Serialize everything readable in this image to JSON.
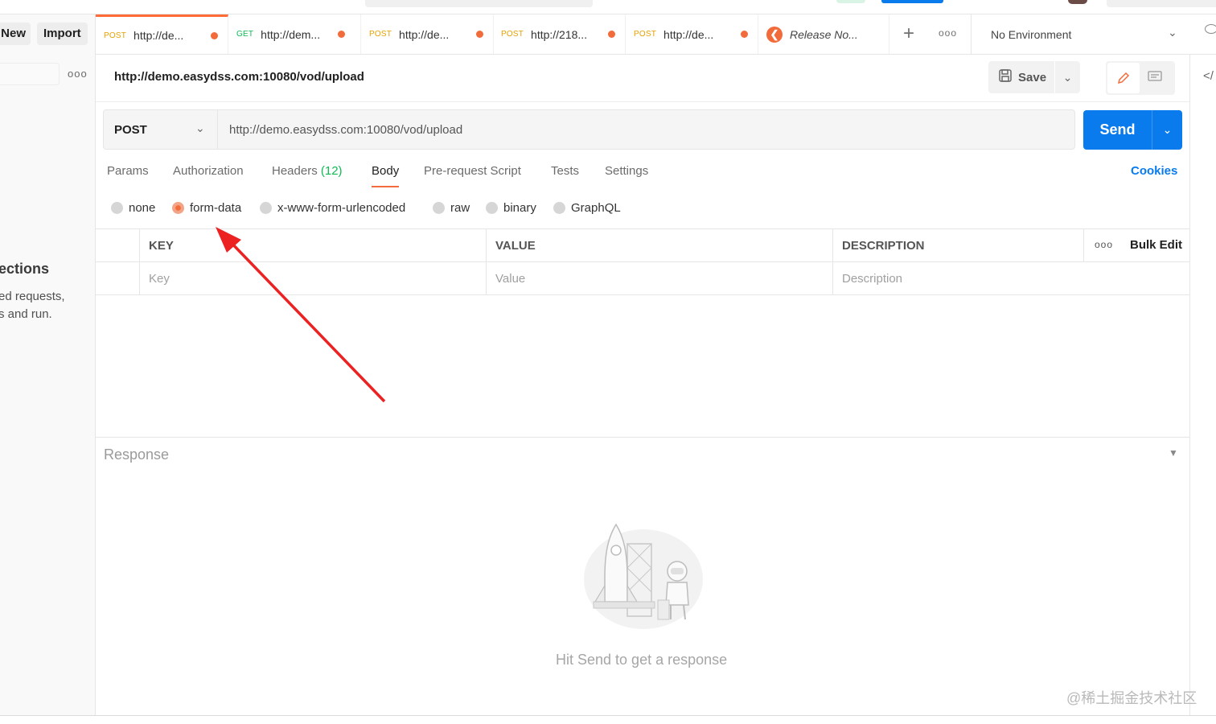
{
  "sidebar": {
    "new_label": "New",
    "import_label": "Import",
    "more_icon": "ellipsis-icon",
    "empty_title": "ections",
    "empty_desc_line1": "ed requests,",
    "empty_desc_line2": "s and run."
  },
  "tabs": [
    {
      "method": "POST",
      "url": "http://de...",
      "unsaved": true,
      "active": true
    },
    {
      "method": "GET",
      "url": "http://dem...",
      "unsaved": true,
      "active": false
    },
    {
      "method": "POST",
      "url": "http://de...",
      "unsaved": true,
      "active": false
    },
    {
      "method": "POST",
      "url": "http://218...",
      "unsaved": true,
      "active": false
    },
    {
      "method": "POST",
      "url": "http://de...",
      "unsaved": true,
      "active": false
    },
    {
      "title": "Release No...",
      "icon": "release-notes-icon"
    }
  ],
  "environment": {
    "selected": "No Environment"
  },
  "request": {
    "title": "http://demo.easydss.com:10080/vod/upload",
    "save_label": "Save",
    "method": "POST",
    "url": "http://demo.easydss.com:10080/vod/upload",
    "send_label": "Send"
  },
  "request_tabs": {
    "params": "Params",
    "authorization": "Authorization",
    "headers": "Headers",
    "headers_count": "(12)",
    "body": "Body",
    "prerequest": "Pre-request Script",
    "tests": "Tests",
    "settings": "Settings",
    "cookies": "Cookies",
    "active": "Body"
  },
  "body_types": {
    "none": "none",
    "form_data": "form-data",
    "urlencoded": "x-www-form-urlencoded",
    "raw": "raw",
    "binary": "binary",
    "graphql": "GraphQL",
    "selected": "form-data"
  },
  "form_table": {
    "headers": {
      "key": "KEY",
      "value": "VALUE",
      "description": "DESCRIPTION"
    },
    "bulk_edit": "Bulk Edit",
    "placeholders": {
      "key": "Key",
      "value": "Value",
      "description": "Description"
    }
  },
  "response": {
    "title": "Response",
    "hint": "Hit Send to get a response"
  },
  "watermark": "@稀土掘金技术社区",
  "colors": {
    "accent": "#f26b3a",
    "send": "#097bed",
    "post": "#e6a100",
    "get": "#0cbb52"
  }
}
